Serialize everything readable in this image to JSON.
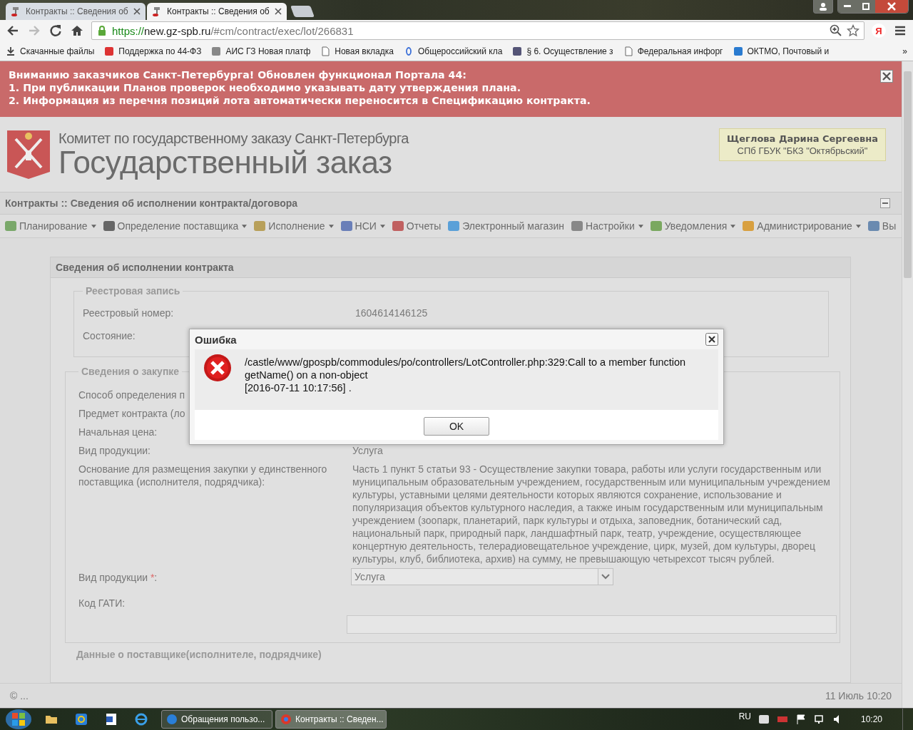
{
  "browser": {
    "tabs": [
      {
        "title": "Контракты :: Сведения об",
        "selected": false
      },
      {
        "title": "Контракты :: Сведения об",
        "selected": true
      }
    ],
    "url": {
      "scheme": "https://",
      "host": "new.gz-spb.ru",
      "path": "/#cm/contract/exec/lot/266831"
    },
    "profile_letter": "Я",
    "bookmarks": [
      {
        "label": "Скачанные файлы"
      },
      {
        "label": "Поддержка по 44-ФЗ"
      },
      {
        "label": "АИС ГЗ Новая платф"
      },
      {
        "label": "Новая вкладка"
      },
      {
        "label": "Общероссийский кла"
      },
      {
        "label": "§ 6. Осуществление з"
      },
      {
        "label": "Федеральная инфорг"
      },
      {
        "label": "ОКТМО, Почтовый и"
      }
    ],
    "bookmarks_more": "»"
  },
  "banner": {
    "lines": [
      "Вниманию заказчиков Санкт-Петербурга! Обновлен функционал Портала 44:",
      "1. При публикации Планов проверок необходимо указывать дату утверждения плана.",
      "2. Информация из перечня позиций лота автоматически переносится в Спецификацию контракта."
    ]
  },
  "header": {
    "org": "Комитет по государственному заказу Санкт-Петербурга",
    "product": "Государственный заказ",
    "user": {
      "name": "Щеглова Дарина Сергеевна",
      "org": "СПб ГБУК \"БКЗ \"Октябрьский\""
    }
  },
  "page_title": "Контракты :: Сведения об исполнении контракта/договора",
  "menu": [
    {
      "label": "Планирование",
      "dropdown": true
    },
    {
      "label": "Определение поставщика",
      "dropdown": true
    },
    {
      "label": "Исполнение",
      "dropdown": true
    },
    {
      "label": "НСИ",
      "dropdown": true
    },
    {
      "label": "Отчеты",
      "dropdown": false
    },
    {
      "label": "Электронный магазин",
      "dropdown": false
    },
    {
      "label": "Настройки",
      "dropdown": true
    },
    {
      "label": "Уведомления",
      "dropdown": true
    },
    {
      "label": "Администрирование",
      "dropdown": true
    },
    {
      "label": "Вы",
      "dropdown": false
    }
  ],
  "panel": {
    "title": "Сведения об исполнении контракта",
    "registry": {
      "legend": "Реестровая запись",
      "rows": [
        {
          "label": "Реестровый номер:",
          "value": "1604614146125"
        },
        {
          "label": "Состояние:"
        }
      ]
    },
    "purchase": {
      "legend": "Сведения о закупке",
      "rows": [
        {
          "label": "Способ определения п"
        },
        {
          "label": "Предмет контракта (ло"
        },
        {
          "label": "Начальная цена:"
        },
        {
          "label": "Вид продукции:",
          "value": "Услуга"
        },
        {
          "label": "Основание для размещения закупки у единственного поставщика (исполнителя, подрядчика):",
          "value": "Часть 1 пункт 5 статьи 93 - Осуществление закупки товара, работы или услуги государственным или муниципальным образовательным учреждением, государственным или муниципальным учреждением культуры, уставными целями деятельности которых являются сохранение, использование и популяризация объектов культурного наследия, а также иным государственным или муниципальным учреждением (зоопарк, планетарий, парк культуры и отдыха, заповедник, ботанический сад, национальный парк, природный парк, ландшафтный парк, театр, учреждение, осуществляющее концертную деятельность, телерадиовещательное учреждение, цирк, музей, дом культуры, дворец культуры, клуб, библиотека, архив) на сумму, не превышающую четырехсот тысяч рублей."
        }
      ],
      "product_select": {
        "label": "Вид продукции",
        "required_mark": "*",
        "suffix": ":",
        "value": "Услуга"
      },
      "gati": {
        "label": "Код ГАТИ:"
      }
    },
    "supplier_legend": "Данные о поставщике(исполнителе, подрядчике)"
  },
  "status_bar": {
    "left": "© ...",
    "right": "11 Июль 10:20"
  },
  "dialog": {
    "title": "Ошибка",
    "message": "/castle/www/gpospb/commodules/po/controllers/LotController.php:329:Call to a member function getName() on a non-object",
    "timestamp": "[2016-07-11 10:17:56] .",
    "button": "OK"
  },
  "taskbar": {
    "windows": [
      {
        "title": "Обращения пользо...",
        "selected": false
      },
      {
        "title": "Контракты :: Сведен...",
        "selected": true
      }
    ],
    "language": "RU",
    "clock": "10:20"
  }
}
